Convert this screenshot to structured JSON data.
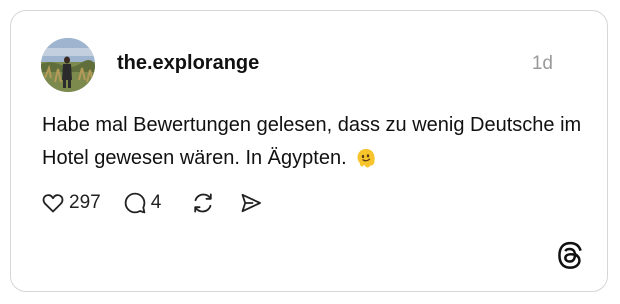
{
  "post": {
    "username": "the.explorange",
    "timestamp": "1d",
    "text": "Habe mal Bewertungen gelesen, dass zu wenig Deutsche im Hotel gewesen wären. In Ägypten.",
    "emoji_icon": "melting-face-emoji"
  },
  "actions": {
    "like_count": "297",
    "reply_count": "4",
    "like_icon": "heart-icon",
    "reply_icon": "comment-icon",
    "repost_icon": "repost-icon",
    "share_icon": "send-icon"
  },
  "brand": {
    "icon": "threads-logo"
  },
  "colors": {
    "text": "#111111",
    "muted": "#9a9a9a",
    "border": "#d6d6d6",
    "emoji": "#f7c52b"
  }
}
